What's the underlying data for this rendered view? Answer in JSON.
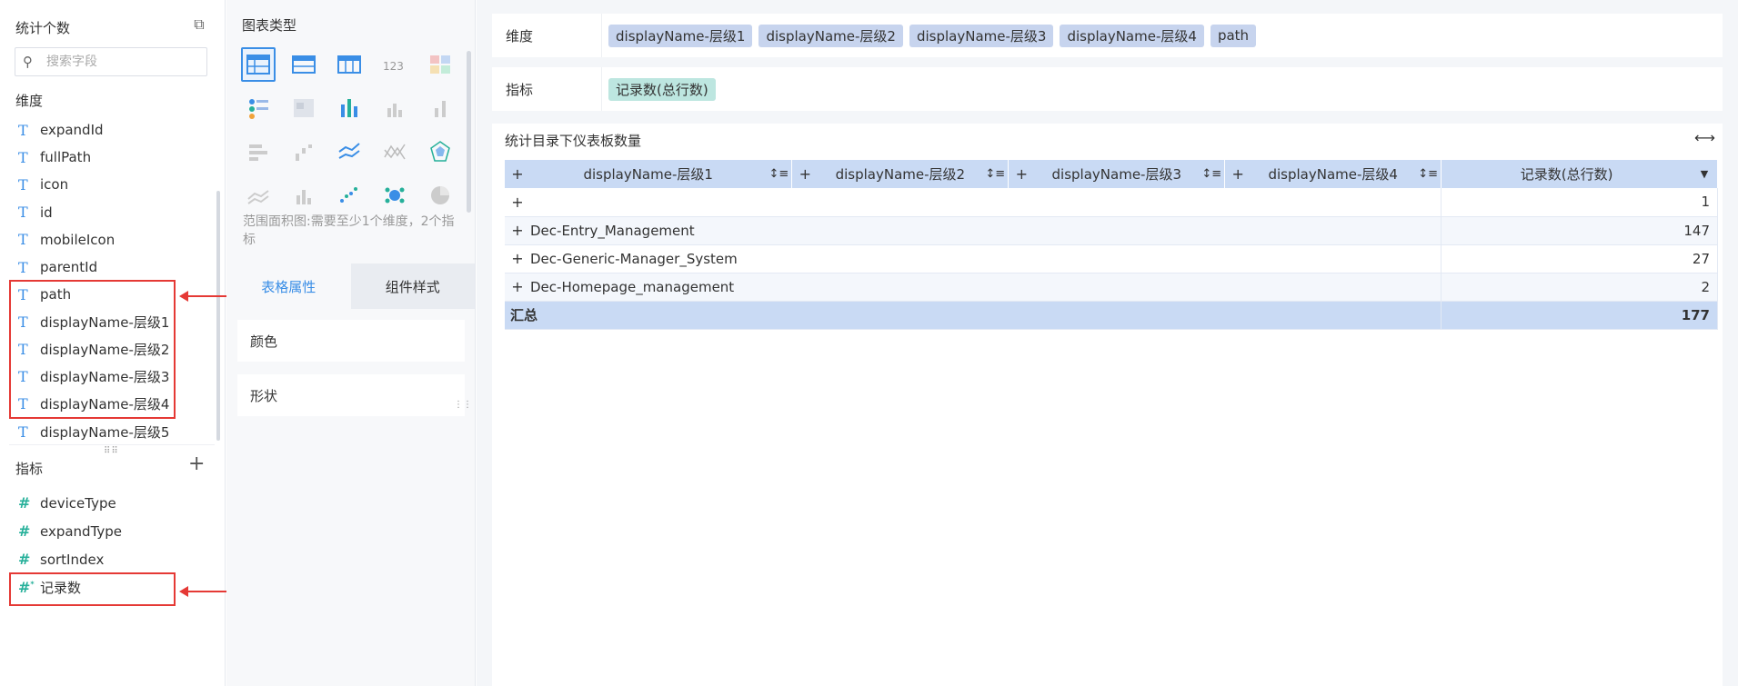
{
  "left": {
    "title": "统计个数",
    "search_placeholder": "搜索字段",
    "dim_section": "维度",
    "dimensions": [
      "expandId",
      "fullPath",
      "icon",
      "id",
      "mobileIcon",
      "parentId",
      "path",
      "displayName-层级1",
      "displayName-层级2",
      "displayName-层级3",
      "displayName-层级4",
      "displayName-层级5"
    ],
    "metric_section": "指标",
    "metrics": [
      "deviceType",
      "expandType",
      "sortIndex",
      "记录数"
    ],
    "anno_dim": "维度",
    "anno_metric": "指标"
  },
  "mid": {
    "title": "图表类型",
    "desc": "范围面积图:需要至少1个维度，2个指标",
    "tab_table": "表格属性",
    "tab_style": "组件样式",
    "prop_color": "颜色",
    "prop_shape": "形状"
  },
  "shelf": {
    "dim_label": "维度",
    "dims": [
      "displayName-层级1",
      "displayName-层级2",
      "displayName-层级3",
      "displayName-层级4",
      "path"
    ],
    "metric_label": "指标",
    "metrics": [
      "记录数(总行数)"
    ]
  },
  "component": {
    "title": "统计目录下仪表板数量",
    "headers": [
      "displayName-层级1",
      "displayName-层级2",
      "displayName-层级3",
      "displayName-层级4",
      "记录数(总行数)"
    ],
    "rows": [
      {
        "label": "",
        "value": "1"
      },
      {
        "label": "Dec-Entry_Management",
        "value": "147"
      },
      {
        "label": "Dec-Generic-Manager_System",
        "value": "27"
      },
      {
        "label": "Dec-Homepage_management",
        "value": "2"
      }
    ],
    "total_label": "汇总",
    "total_value": "177"
  },
  "colors": {
    "accent": "#3a8ee6",
    "dim_pill": "#c7d4ee",
    "metric_pill": "#bde6e0",
    "header": "#c9daf4",
    "annotation": "#e53935"
  }
}
